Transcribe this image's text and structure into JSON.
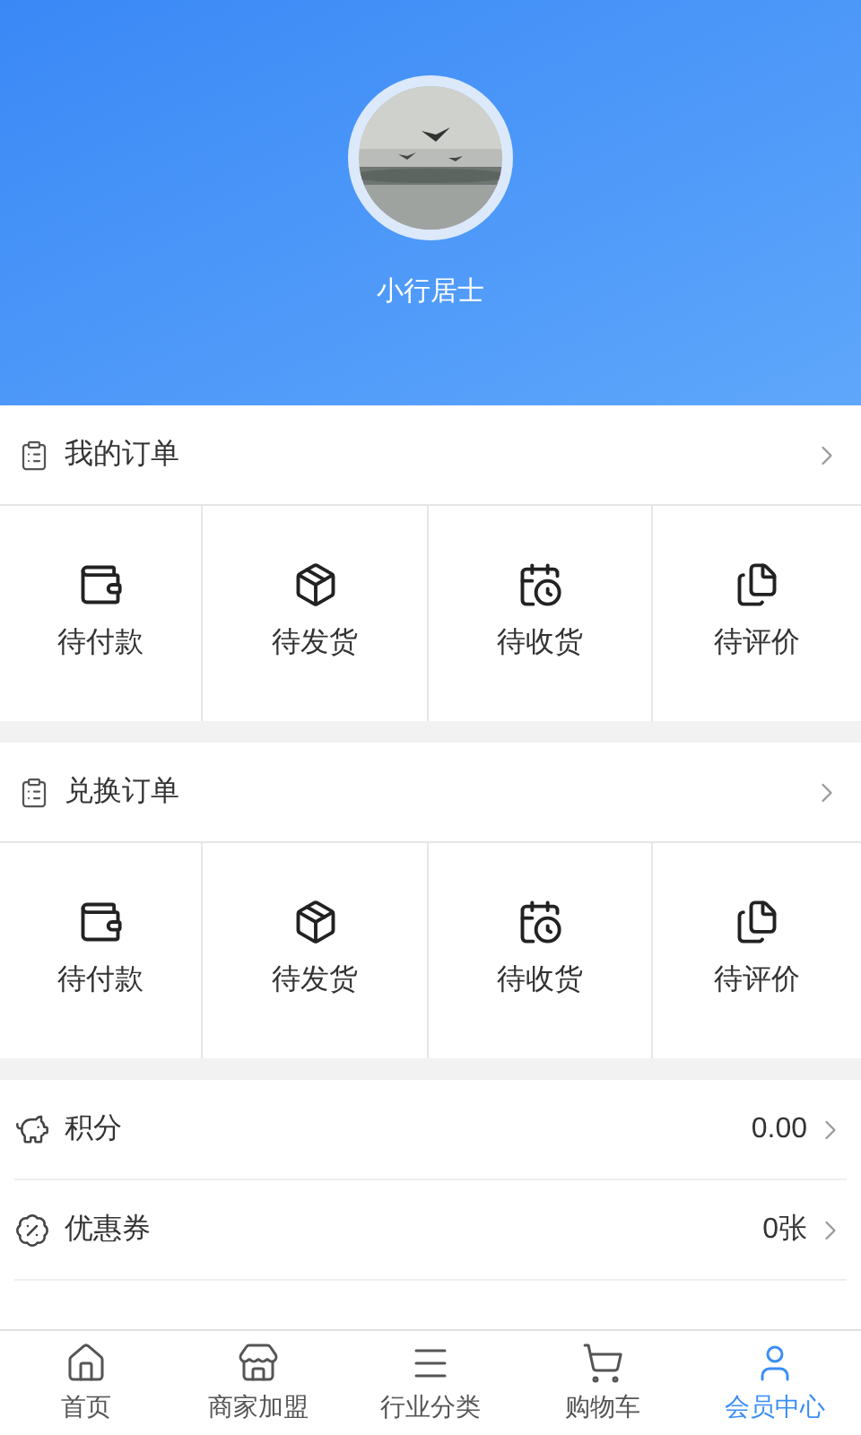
{
  "profile": {
    "name": "小行居士"
  },
  "order_sections": [
    {
      "title": "我的订单",
      "items": [
        {
          "label": "待付款",
          "kind": "wallet"
        },
        {
          "label": "待发货",
          "kind": "box"
        },
        {
          "label": "待收货",
          "kind": "receive"
        },
        {
          "label": "待评价",
          "kind": "review"
        }
      ]
    },
    {
      "title": "兑换订单",
      "items": [
        {
          "label": "待付款",
          "kind": "wallet"
        },
        {
          "label": "待发货",
          "kind": "box"
        },
        {
          "label": "待收货",
          "kind": "receive"
        },
        {
          "label": "待评价",
          "kind": "review"
        }
      ]
    }
  ],
  "account_rows": [
    {
      "label": "积分",
      "value": "0.00",
      "kind": "piggy"
    },
    {
      "label": "优惠券",
      "value": "0张",
      "kind": "coupon"
    }
  ],
  "tab_bar": [
    {
      "label": "首页",
      "kind": "home",
      "selected": false
    },
    {
      "label": "商家加盟",
      "kind": "store",
      "selected": false
    },
    {
      "label": "行业分类",
      "kind": "menu",
      "selected": false
    },
    {
      "label": "购物车",
      "kind": "cart",
      "selected": false
    },
    {
      "label": "会员中心",
      "kind": "user",
      "selected": true
    }
  ]
}
